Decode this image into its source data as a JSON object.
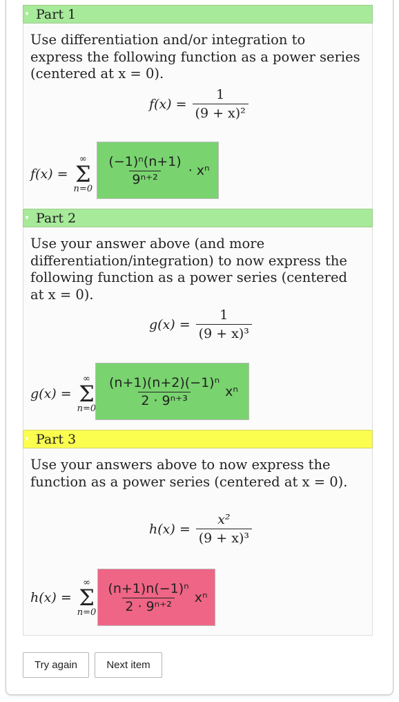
{
  "parts": [
    {
      "header": "Part 1",
      "question": "Use differentiation and/or integration to express the following function as a power series (centered at x = 0).",
      "display_lhs": "f(x) =",
      "display_num": "1",
      "display_den": "(9 + x)²",
      "sum_lhs": "f(x) =",
      "sum_top": "∞",
      "sum_bottom": "n=0",
      "answer_num": "(−1)ⁿ(n+1)",
      "answer_den": "9ⁿ⁺²",
      "answer_suffix": "· xⁿ",
      "answer_status": "correct"
    },
    {
      "header": "Part 2",
      "question": "Use your answer above (and more differentiation/integration) to now express the following function as a power series (centered at x = 0).",
      "display_lhs": "g(x) =",
      "display_num": "1",
      "display_den": "(9 + x)³",
      "sum_lhs": "g(x) =",
      "sum_top": "∞",
      "sum_bottom": "n=0",
      "answer_num": "(n+1)(n+2)(−1)ⁿ",
      "answer_den": "2 · 9ⁿ⁺³",
      "answer_suffix": "xⁿ",
      "answer_status": "correct"
    },
    {
      "header": "Part 3",
      "question": "Use your answers above to now express the function as a power series (centered at x = 0).",
      "display_lhs": "h(x) =",
      "display_num": "x²",
      "display_den": "(9 + x)³",
      "sum_lhs": "h(x) =",
      "sum_top": "∞",
      "sum_bottom": "n=0",
      "answer_num": "(n+1)n(−1)ⁿ",
      "answer_den": "2 · 9ⁿ⁺²",
      "answer_suffix": "xⁿ",
      "answer_status": "incorrect"
    }
  ],
  "buttons": {
    "try_again": "Try again",
    "next_item": "Next item"
  },
  "colors": {
    "header_green": "#a7ea9a",
    "header_yellow": "#fbfd4f",
    "correct": "#79d36f",
    "incorrect": "#ef6585"
  }
}
